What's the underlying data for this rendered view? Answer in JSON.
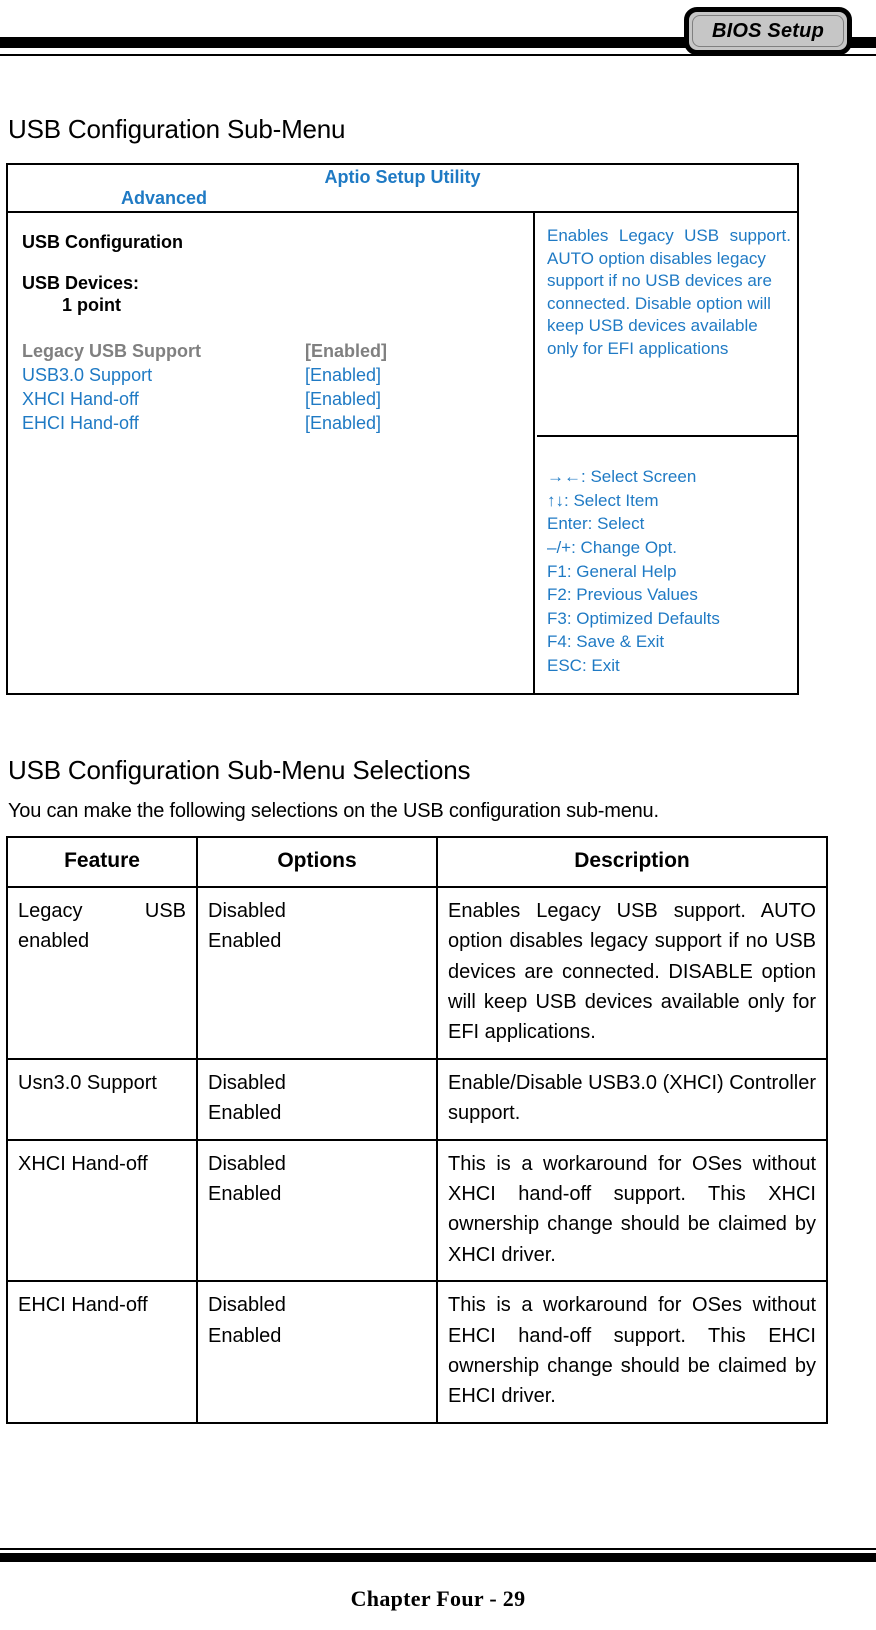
{
  "header": {
    "badge_label": "BIOS Setup"
  },
  "sections": {
    "bios_screen_heading": "USB Configuration Sub-Menu",
    "selections_heading": "USB Configuration Sub-Menu Selections",
    "selections_intro": "You can make the following selections on the USB configuration sub-menu."
  },
  "bios_screen": {
    "title": "Aptio Setup Utility",
    "active_tab": "Advanced",
    "config_title": "USB Configuration",
    "devices_label": "USB Devices:",
    "devices_value": "1 point",
    "options": [
      {
        "label": "Legacy USB Support",
        "value": "[Enabled]",
        "selected": true
      },
      {
        "label": "USB3.0 Support",
        "value": "[Enabled]",
        "selected": false
      },
      {
        "label": "XHCI Hand-off",
        "value": "[Enabled]",
        "selected": false
      },
      {
        "label": "EHCI Hand-off",
        "value": "[Enabled]",
        "selected": false
      }
    ],
    "help_lines": [
      "Enables Legacy USB support.",
      "AUTO option disables legacy support if no USB devices are connected. Disable option will keep USB devices available only for EFI applications"
    ],
    "nav_keys": [
      "→←: Select Screen",
      "↑↓: Select Item",
      "Enter: Select",
      "–/+: Change Opt.",
      "F1: General Help",
      "F2: Previous Values",
      "F3: Optimized Defaults",
      "F4: Save & Exit",
      "ESC: Exit"
    ],
    "colors": {
      "accent_blue": "#1f7ac4",
      "selected_gray": "#808080",
      "badge_gray": "#c6c6c6"
    }
  },
  "selections_table": {
    "columns": [
      "Feature",
      "Options",
      "Description"
    ],
    "rows": [
      {
        "feature": "Legacy USB enabled",
        "options": [
          "Disabled",
          "Enabled"
        ],
        "description": "Enables Legacy USB support. AUTO option disables legacy support if no USB devices are connected. DISABLE option will keep USB devices available only for EFI applications."
      },
      {
        "feature": "Usn3.0 Support",
        "options": [
          "Disabled",
          "Enabled"
        ],
        "description": "Enable/Disable USB3.0 (XHCI) Controller support."
      },
      {
        "feature": "XHCI Hand-off",
        "options": [
          "Disabled",
          "Enabled"
        ],
        "description": "This is a workaround for OSes without XHCI hand-off support. This XHCI ownership change should be claimed by XHCI driver."
      },
      {
        "feature": "EHCI Hand-off",
        "options": [
          "Disabled",
          "Enabled"
        ],
        "description": "This is a workaround for OSes without EHCI hand-off support. This EHCI ownership change should be claimed by EHCI driver."
      }
    ]
  },
  "footer": {
    "page_label": "Chapter Four - 29"
  }
}
